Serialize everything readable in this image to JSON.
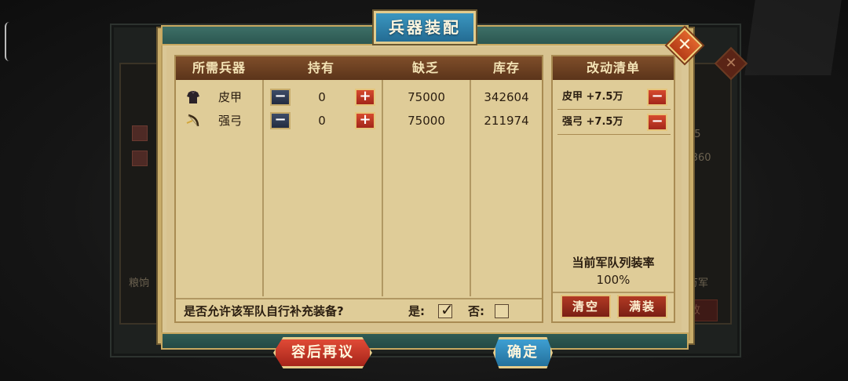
{
  "modal": {
    "title": "兵器装配",
    "close_symbol": "✕"
  },
  "table": {
    "headers": [
      "所需兵器",
      "持有",
      "缺乏",
      "库存"
    ],
    "rows": [
      {
        "icon": "armor-icon",
        "name": "皮甲",
        "held": "0",
        "lacking": "75000",
        "stock": "342604"
      },
      {
        "icon": "bow-icon",
        "name": "强弓",
        "held": "0",
        "lacking": "75000",
        "stock": "211974"
      }
    ],
    "minus_symbol": "−",
    "plus_symbol": "+"
  },
  "resupply": {
    "question": "是否允许该军队自行补充装备?",
    "yes_label": "是:",
    "no_label": "否:",
    "yes_checked": true,
    "check_mark": "✓"
  },
  "changes": {
    "title": "改动清单",
    "items": [
      {
        "text": "皮甲 +7.5万"
      },
      {
        "text": "强弓 +7.5万"
      }
    ],
    "rate_label": "当前军队列装率",
    "rate_value": "100%",
    "clear_label": "清空",
    "full_label": "满装"
  },
  "footer": {
    "later_label": "容后再议",
    "confirm_label": "确定"
  },
  "background": {
    "left_text": "粮饷",
    "right_text": "万军",
    "num_a": "25",
    "num_b": "-360",
    "btn_text": "改"
  }
}
